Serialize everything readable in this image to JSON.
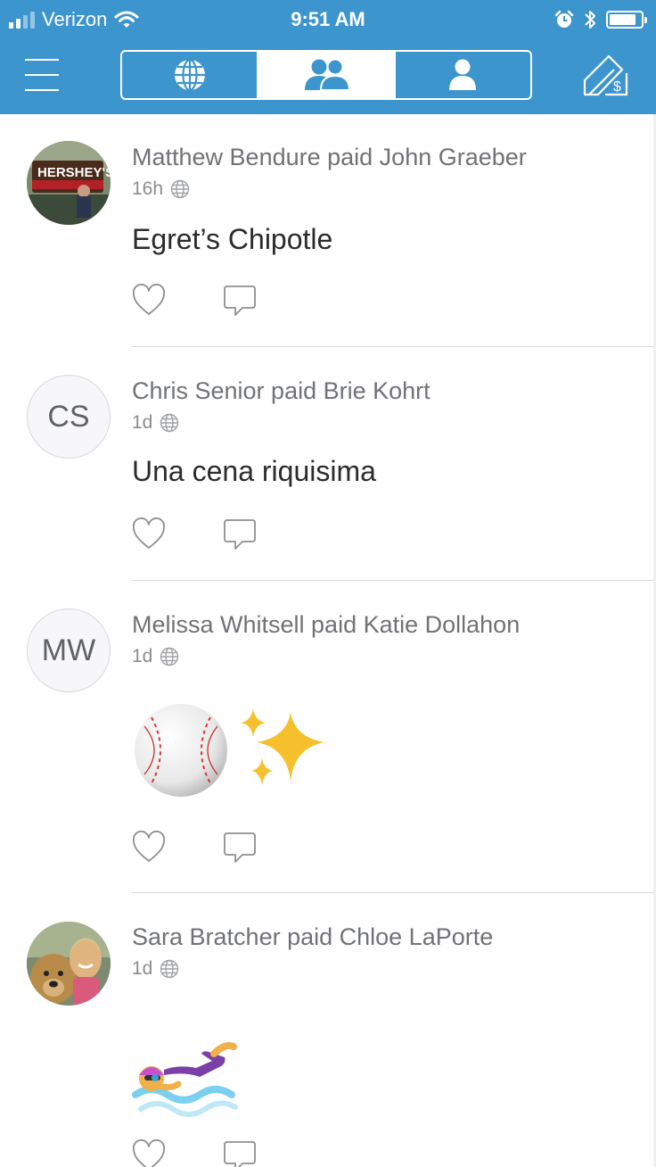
{
  "status_bar": {
    "carrier": "Verizon",
    "time": "9:51 AM",
    "signal_bars": 4,
    "signal_bars_filled": 2,
    "battery_level": 0.85
  },
  "nav": {
    "menu_icon": "hamburger-menu-icon",
    "tabs": [
      {
        "icon": "globe-icon",
        "label": "Public",
        "active": false
      },
      {
        "icon": "friends-icon",
        "label": "Friends",
        "active": true
      },
      {
        "icon": "person-icon",
        "label": "Me",
        "active": false
      }
    ],
    "pay_icon": "pay-or-request-icon"
  },
  "colors": {
    "brand_blue": "#3d95ce",
    "header_text": "#707275",
    "note_text": "#2b2b2b",
    "meta_text": "#8a8c8f",
    "divider": "#d8d8d8"
  },
  "feed": [
    {
      "actor": "Matthew Bendure",
      "verb": "paid",
      "target": "John Graeber",
      "headline": "Matthew Bendure paid John Graeber",
      "time": "16h",
      "audience_icon": "globe-icon",
      "avatar": {
        "type": "photo"
      },
      "note": "Egret’s Chipotle"
    },
    {
      "actor": "Chris Senior",
      "verb": "paid",
      "target": "Brie Kohrt",
      "headline": "Chris Senior paid Brie Kohrt",
      "time": "1d",
      "audience_icon": "globe-icon",
      "avatar": {
        "type": "initials",
        "initials": "CS"
      },
      "note": "Una cena riquisima"
    },
    {
      "actor": "Melissa Whitsell",
      "verb": "paid",
      "target": "Katie Dollahon",
      "headline": "Melissa Whitsell paid Katie Dollahon",
      "time": "1d",
      "audience_icon": "globe-icon",
      "avatar": {
        "type": "initials",
        "initials": "MW"
      },
      "note_emoji": [
        "baseball-emoji",
        "sparkles-emoji"
      ]
    },
    {
      "actor": "Sara Bratcher",
      "verb": "paid",
      "target": "Chloe LaPorte",
      "headline": "Sara Bratcher paid Chloe LaPorte",
      "time": "1d",
      "audience_icon": "globe-icon",
      "avatar": {
        "type": "photo"
      },
      "note_emoji": [
        "swimmer-emoji"
      ]
    }
  ],
  "story_actions": {
    "like_icon": "heart-icon",
    "comment_icon": "comment-bubble-icon"
  }
}
